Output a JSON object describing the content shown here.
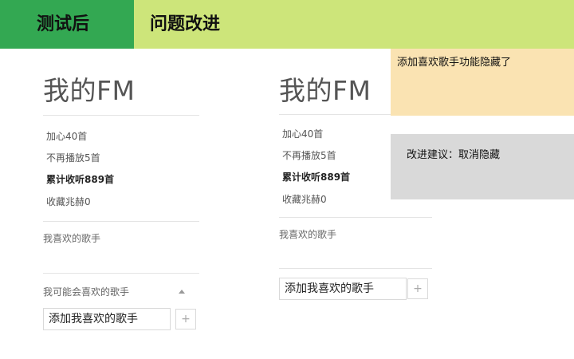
{
  "header": {
    "after_test_label": "测试后",
    "improvement_label": "问题改进"
  },
  "left_panel": {
    "title": "我的FM",
    "stats": [
      "加心40首",
      "不再播放5首",
      "累计收听889首",
      "收藏兆赫0"
    ],
    "favorite_artists_label": "我喜欢的歌手",
    "suggested_artists_label": "我可能会喜欢的歌手",
    "add_input_value": "添加我喜欢的歌手",
    "add_button_label": "+"
  },
  "right_panel": {
    "title": "我的FM",
    "stats": [
      "加心40首",
      "不再播放5首",
      "累计收听889首",
      "收藏兆赫0"
    ],
    "favorite_artists_label": "我喜欢的歌手",
    "add_input_value": "添加我喜欢的歌手",
    "add_button_label": "+"
  },
  "notes": {
    "issue": "添加喜欢歌手功能隐藏了",
    "suggestion": "改进建议：取消隐藏"
  },
  "colors": {
    "header_bg": "#cde57a",
    "after_tag_bg": "#33a852",
    "issue_note_bg": "#fae3b2",
    "suggestion_note_bg": "#d9d9d9"
  }
}
